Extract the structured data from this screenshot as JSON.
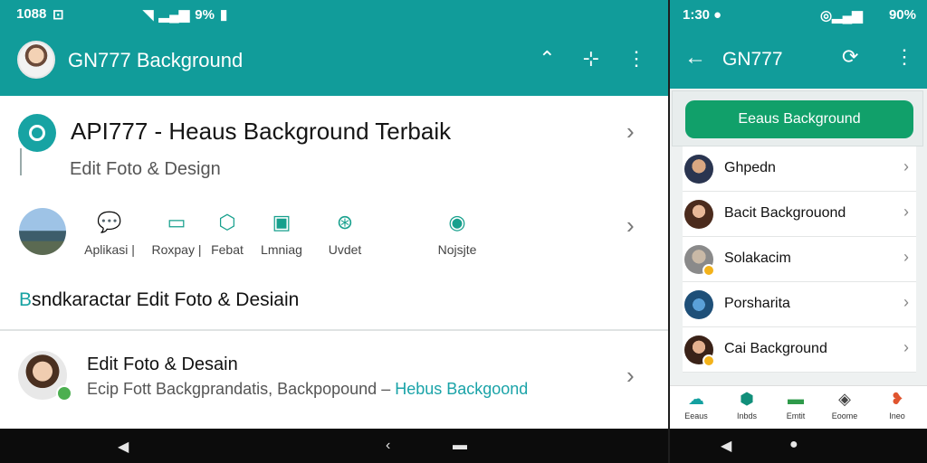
{
  "left": {
    "status": {
      "time": "1088",
      "icon_label": "⊡",
      "battery_text": "9%"
    },
    "appbar": {
      "title": "GN777 Background"
    },
    "hero": {
      "title": "API777 - Heaus Background Terbaik",
      "subtitle": "Edit Foto & Design"
    },
    "categories": [
      {
        "label": "Aplikasi |",
        "icon": "chat-badge-icon"
      },
      {
        "label": "Roxpay |",
        "icon": "chat-badge-icon"
      },
      {
        "label": "Febat",
        "icon": "cube-icon"
      },
      {
        "label": "Lmniag",
        "icon": "image-frame-icon"
      },
      {
        "label": "Uvdet",
        "icon": "network-icon"
      },
      {
        "label": "Nojsjte",
        "icon": "chart-icon"
      }
    ],
    "section_heading": {
      "cap": "B",
      "rest": "sndkaractar Edit Foto & Desiain"
    },
    "row": {
      "title": "Edit Foto & Desain",
      "subtitle": "Ecip Fott Backgprandatis, Backpopound – ",
      "highlight": "Hebus Backgoond"
    }
  },
  "right": {
    "status": {
      "time": "1:30",
      "battery": "90%"
    },
    "appbar": {
      "title": "GN777"
    },
    "primary_button": "Eeaus Background",
    "list": [
      {
        "name": "Ghpedn"
      },
      {
        "name": "Bacit Backgrouond"
      },
      {
        "name": "Solakacim"
      },
      {
        "name": "Porsharita"
      },
      {
        "name": "Cai Background"
      }
    ],
    "tabs": [
      {
        "label": "Eeaus"
      },
      {
        "label": "Inbds"
      },
      {
        "label": "Emtit"
      },
      {
        "label": "Eoome"
      },
      {
        "label": "Ineo"
      }
    ]
  },
  "colors": {
    "teal": "#119c9a",
    "green": "#11a06a",
    "accent": "#1aa3a8"
  }
}
